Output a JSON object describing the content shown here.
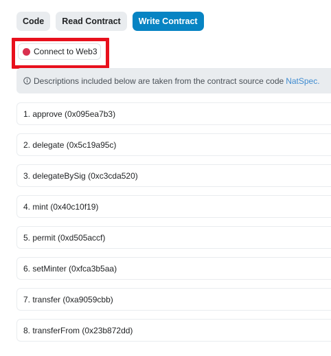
{
  "tabs": [
    {
      "label": "Code"
    },
    {
      "label": "Read Contract"
    },
    {
      "label": "Write Contract"
    }
  ],
  "connect": {
    "label": "Connect to Web3",
    "status_color": "#d9304f",
    "highlight_color": "#e8101c"
  },
  "notice": {
    "icon": "info-icon",
    "text": "Descriptions included below are taken from the contract source code",
    "link": "NatSpec."
  },
  "functions": [
    {
      "label": "1. approve (0x095ea7b3)"
    },
    {
      "label": "2. delegate (0x5c19a95c)"
    },
    {
      "label": "3. delegateBySig (0xc3cda520)"
    },
    {
      "label": "4. mint (0x40c10f19)"
    },
    {
      "label": "5. permit (0xd505accf)"
    },
    {
      "label": "6. setMinter (0xfca3b5aa)"
    },
    {
      "label": "7. transfer (0xa9059cbb)"
    },
    {
      "label": "8. transferFrom (0x23b872dd)"
    }
  ],
  "colors": {
    "accent": "#0784c3",
    "tab_bg": "#e9ecef",
    "link": "#3e8bd0"
  }
}
